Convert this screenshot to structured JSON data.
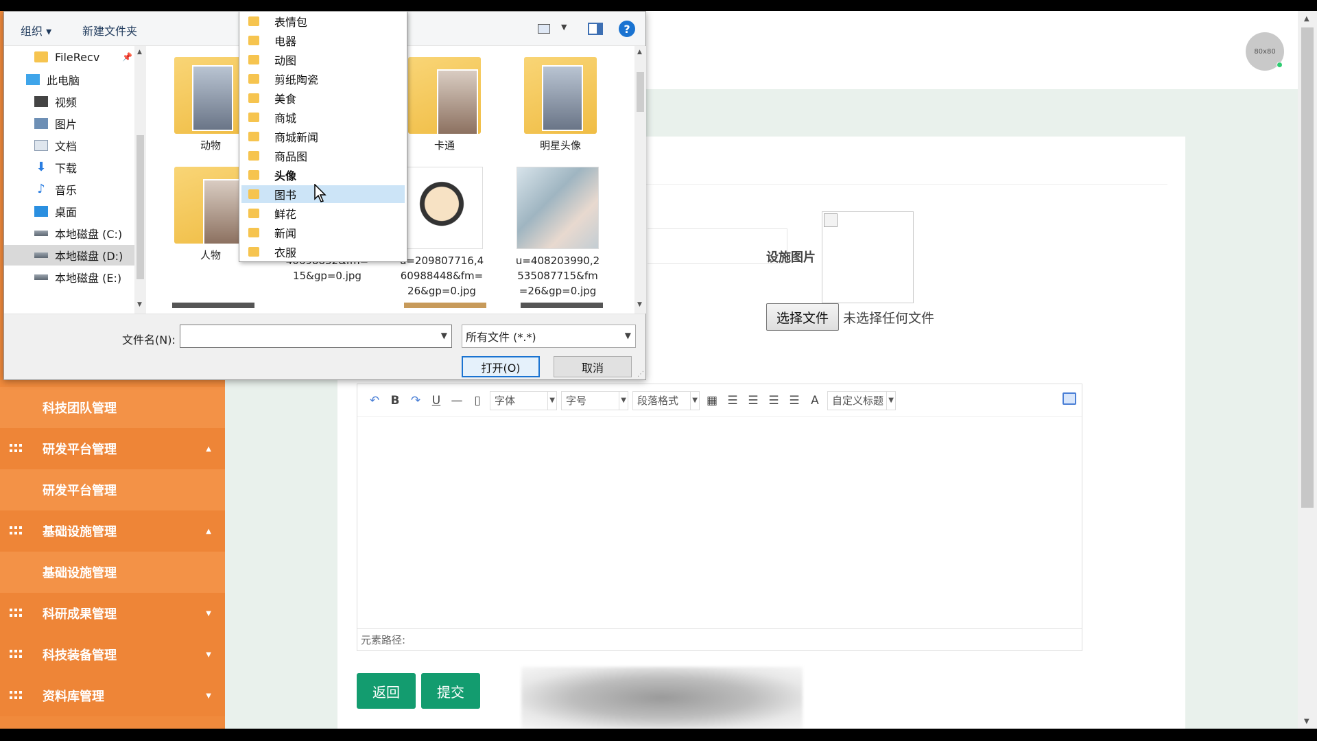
{
  "app": {
    "avatar_text": "80x80",
    "sidebar": [
      {
        "label": "科技团队管理",
        "kind": "sub"
      },
      {
        "label": "研发平台管理",
        "kind": "group",
        "caret": "▲"
      },
      {
        "label": "研发平台管理",
        "kind": "sub"
      },
      {
        "label": "基础设施管理",
        "kind": "group",
        "caret": "▲"
      },
      {
        "label": "基础设施管理",
        "kind": "sub"
      },
      {
        "label": "科研成果管理",
        "kind": "group",
        "caret": "▼"
      },
      {
        "label": "科技装备管理",
        "kind": "group",
        "caret": "▼"
      },
      {
        "label": "资料库管理",
        "kind": "group",
        "caret": "▼"
      }
    ],
    "form": {
      "image_label": "设施图片",
      "choose_file": "选择文件",
      "no_file": "未选择任何文件"
    },
    "editor": {
      "font_select": "字体",
      "size_select": "字号",
      "paragraph_select": "段落格式",
      "font_color": "A",
      "custom_title": "自定义标题",
      "element_path": "元素路径:"
    },
    "buttons": {
      "back": "返回",
      "submit": "提交"
    }
  },
  "dialog": {
    "toolbar": {
      "organize": "组织 ▾",
      "new_folder": "新建文件夹",
      "help": "?"
    },
    "nav": [
      {
        "label": "FileRecv",
        "icon": "folder-icon",
        "pinned": true
      },
      {
        "label": "此电脑",
        "icon": "computer-icon"
      },
      {
        "label": "视频",
        "icon": "video-icon"
      },
      {
        "label": "图片",
        "icon": "pictures-icon"
      },
      {
        "label": "文档",
        "icon": "documents-icon"
      },
      {
        "label": "下载",
        "icon": "download-icon"
      },
      {
        "label": "音乐",
        "icon": "music-icon"
      },
      {
        "label": "桌面",
        "icon": "desktop-icon"
      },
      {
        "label": "本地磁盘 (C:)",
        "icon": "disk-icon"
      },
      {
        "label": "本地磁盘 (D:)",
        "icon": "disk-icon",
        "selected": true
      },
      {
        "label": "本地磁盘 (E:)",
        "icon": "disk-icon"
      }
    ],
    "files": [
      {
        "name": "动物",
        "type": "folder"
      },
      {
        "name": "卡通",
        "type": "folder"
      },
      {
        "name": "明星头像",
        "type": "folder"
      },
      {
        "name": "人物",
        "type": "folder"
      },
      {
        "name": "40698832&fm=15&gp=0.jpg",
        "type": "image"
      },
      {
        "name": "u=209807716,460988448&fm=26&gp=0.jpg",
        "type": "image"
      },
      {
        "name": "u=408203990,2535087715&fm=26&gp=0.jpg",
        "type": "image"
      }
    ],
    "filename_label": "文件名(N):",
    "filename_value": "",
    "filetype": "所有文件 (*.*)",
    "open_button": "打开(O)",
    "cancel_button": "取消"
  },
  "folder_dropdown": {
    "items": [
      "表情包",
      "电器",
      "动图",
      "剪纸陶瓷",
      "美食",
      "商城",
      "商城新闻",
      "商品图",
      "头像",
      "图书",
      "鲜花",
      "新闻",
      "衣服"
    ],
    "highlighted": "图书",
    "bold": "头像"
  }
}
